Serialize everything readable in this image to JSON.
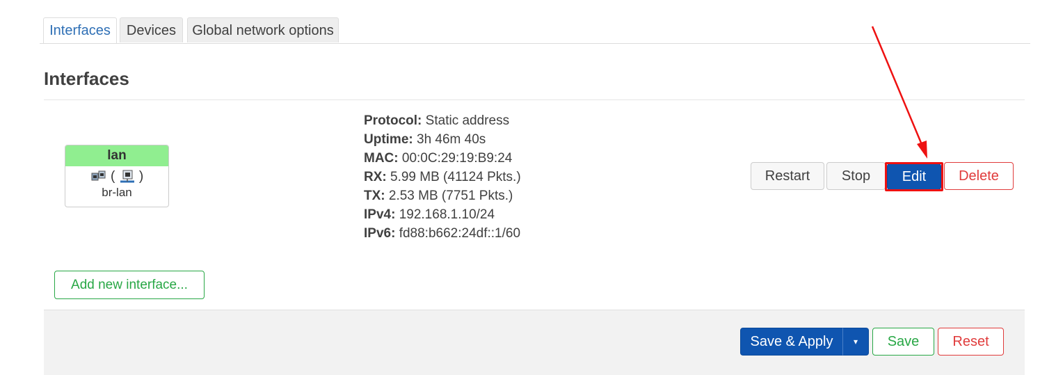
{
  "tabs": [
    {
      "label": "Interfaces",
      "active": true
    },
    {
      "label": "Devices",
      "active": false
    },
    {
      "label": "Global network options",
      "active": false
    }
  ],
  "section_title": "Interfaces",
  "interface": {
    "name": "lan",
    "icons_text": "(",
    "icons_text_close": ")",
    "device": "br-lan",
    "header_color": "#90ee90",
    "icons": [
      "network-ports-icon",
      "network-bridge-icon"
    ]
  },
  "status": {
    "protocol": {
      "label": "Protocol:",
      "value": "Static address"
    },
    "uptime": {
      "label": "Uptime:",
      "value": "3h 46m 40s"
    },
    "mac": {
      "label": "MAC:",
      "value": "00:0C:29:19:B9:24"
    },
    "rx": {
      "label": "RX:",
      "value": "5.99 MB (41124 Pkts.)"
    },
    "tx": {
      "label": "TX:",
      "value": "2.53 MB (7751 Pkts.)"
    },
    "ipv4": {
      "label": "IPv4:",
      "value": "192.168.1.10/24"
    },
    "ipv6": {
      "label": "IPv6:",
      "value": "fd88:b662:24df::1/60"
    }
  },
  "actions": {
    "restart": "Restart",
    "stop": "Stop",
    "edit": "Edit",
    "delete": "Delete"
  },
  "add_interface": "Add new interface...",
  "footer": {
    "save_apply": "Save & Apply",
    "caret": "▾",
    "save": "Save",
    "reset": "Reset"
  },
  "colors": {
    "primary": "#0f55b0",
    "danger": "#e03b3b",
    "success": "#28a745",
    "annotation": "#ee1111"
  }
}
